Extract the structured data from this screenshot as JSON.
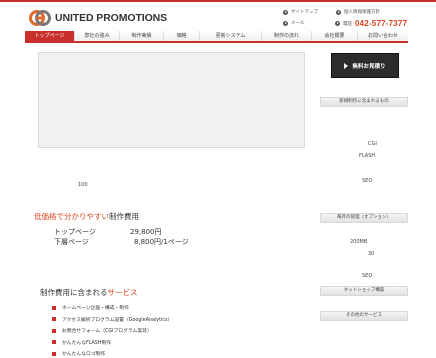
{
  "header": {
    "logo_text": "UNITED PROMOTIONS",
    "util_links": [
      {
        "label": "サイトマップ"
      },
      {
        "label": "個人情報保護方針"
      },
      {
        "label": "メール"
      }
    ],
    "phone_label": "電話",
    "phone_number": "042-577-7377"
  },
  "nav": {
    "items": [
      {
        "label": "トップページ"
      },
      {
        "label": "弊社の強み"
      },
      {
        "label": "制作実績"
      },
      {
        "label": "価格"
      },
      {
        "label": "更新システム"
      },
      {
        "label": "制作の流れ"
      },
      {
        "label": "会社概要"
      },
      {
        "label": "お問い合わせ"
      }
    ]
  },
  "main": {
    "small_number": "100",
    "price_title_red": "低価格で分かりやすい",
    "price_title_rest": "制作費用",
    "prices": [
      {
        "label": "トップページ",
        "value": "29,800円"
      },
      {
        "label": "下層ページ",
        "value": "8,800円/1ページ"
      }
    ],
    "services_title_prefix": "制作費用に含まれる",
    "services_title_red": "サービス",
    "services": [
      {
        "label": "ホームページ企画・構成・制作"
      },
      {
        "label": "アクセス解析プログラム設置（GoogleAnalytics）"
      },
      {
        "label": "お問合せフォーム（CGIプログラム実装）"
      },
      {
        "label": "かんたんなFLASH制作"
      },
      {
        "label": "かんたんなロゴ制作"
      }
    ]
  },
  "sidebar": {
    "cta_label": "無料お見積り",
    "box1_title": "新規制作に含まれるもの",
    "box1_items": [
      {
        "label": "CGI"
      },
      {
        "label": "FLASH"
      },
      {
        "label": "SEO"
      }
    ],
    "box2_title": "毎月の管理（オプション）",
    "box2_items": [
      {
        "label": "200MB"
      },
      {
        "label": "30"
      },
      {
        "label": "SEO"
      }
    ],
    "box3_title": "ネットショップ構築",
    "box4_title": "その他のサービス"
  },
  "colors": {
    "accent": "#c9302c",
    "orange": "#d9441f"
  }
}
